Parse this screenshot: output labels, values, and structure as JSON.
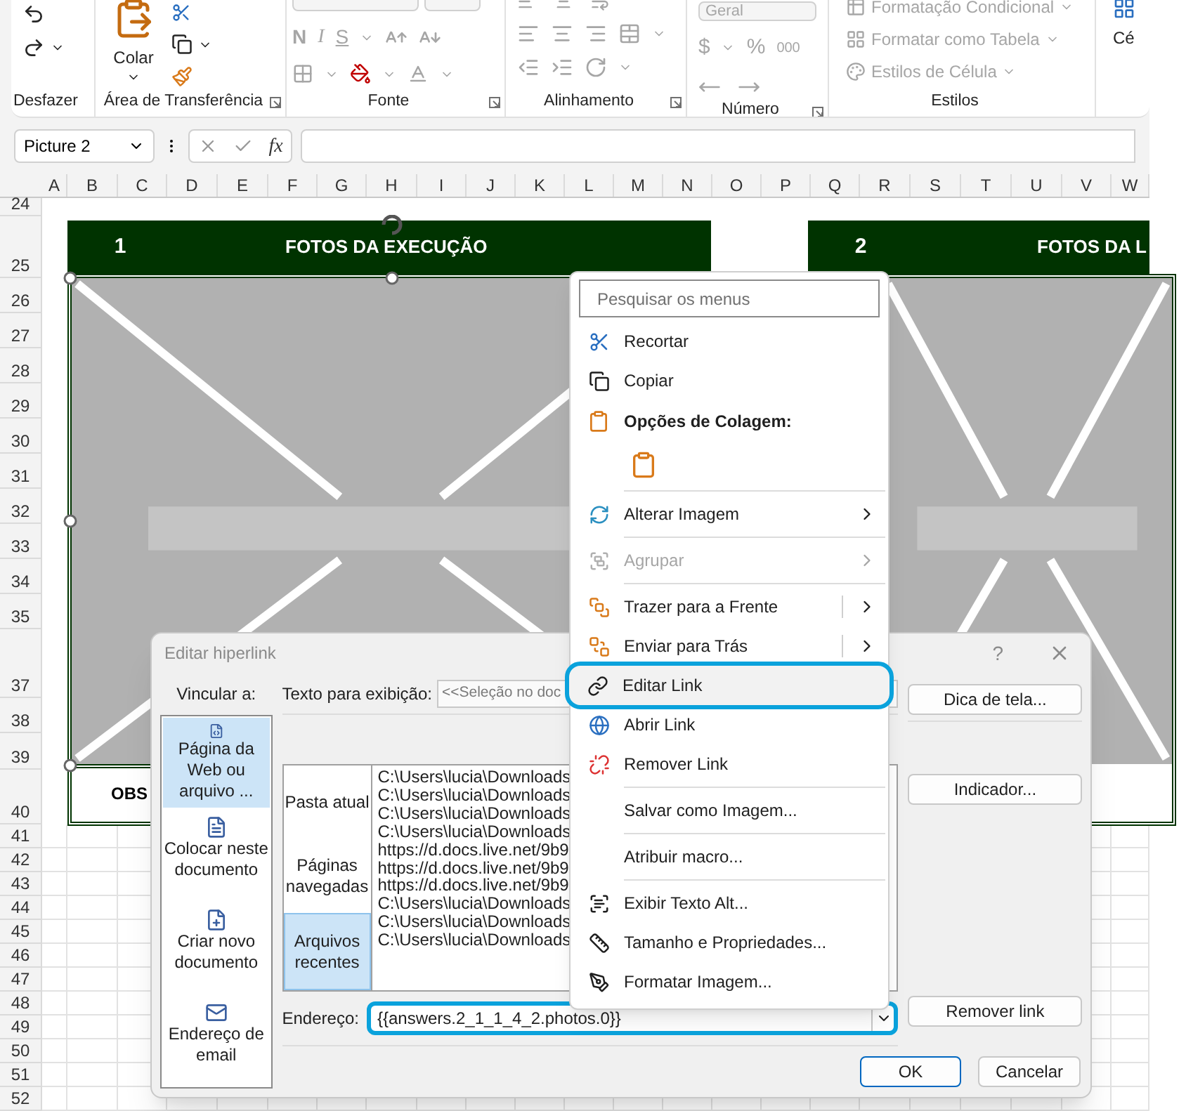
{
  "ribbon": {
    "groups": [
      {
        "kind": "undo",
        "label": "Desfazer",
        "disabled": false
      },
      {
        "kind": "clipboard",
        "label": "Área de Transferência",
        "disabled": false,
        "paste": "Colar"
      },
      {
        "kind": "font",
        "label": "Fonte",
        "disabled": true,
        "bold": "N",
        "italic": "I",
        "underline": "S"
      },
      {
        "kind": "alignment",
        "label": "Alinhamento",
        "disabled": true
      },
      {
        "kind": "number",
        "label": "Número",
        "disabled": true,
        "format": "Geral",
        "currency": "$",
        "percent": "%",
        "thousands": "000"
      },
      {
        "kind": "styles",
        "label": "Estilos",
        "disabled": true,
        "items": [
          "Formatação Condicional",
          "Formatar como Tabela",
          "Estilos de Célula"
        ]
      },
      {
        "kind": "cells",
        "label": "Cé",
        "disabled": false
      }
    ]
  },
  "formula_bar": {
    "name_box": "Picture 2",
    "function_label": "fx"
  },
  "sheet": {
    "columns": [
      "A",
      "B",
      "C",
      "D",
      "E",
      "F",
      "G",
      "H",
      "I",
      "J",
      "K",
      "L",
      "M",
      "N",
      "O",
      "P",
      "Q",
      "R",
      "S",
      "T",
      "U",
      "V",
      "W"
    ],
    "rows": [
      "24",
      "25",
      "26",
      "27",
      "28",
      "29",
      "30",
      "31",
      "32",
      "33",
      "34",
      "35",
      "37",
      "38",
      "39",
      "40",
      "41",
      "42",
      "43",
      "44",
      "45",
      "46",
      "47",
      "48",
      "49",
      "50",
      "51",
      "52"
    ],
    "blocks": [
      {
        "number": "1",
        "title": "FOTOS DA EXECUÇÃO"
      },
      {
        "number": "2",
        "title": "FOTOS DA L"
      }
    ],
    "obs": "OBS"
  },
  "context_menu": {
    "search_placeholder": "Pesquisar os menus",
    "items": [
      {
        "kind": "item",
        "label": "Recortar",
        "selected": false,
        "disabled": false,
        "submenu": false,
        "split": false,
        "circled": false
      },
      {
        "kind": "item",
        "label": "Copiar",
        "selected": false,
        "disabled": false,
        "submenu": false,
        "split": false,
        "circled": false
      },
      {
        "kind": "header",
        "label": "Opções de Colagem:"
      },
      {
        "kind": "paste_options"
      },
      {
        "kind": "separator"
      },
      {
        "kind": "item",
        "label": "Alterar Imagem",
        "selected": false,
        "disabled": false,
        "submenu": true,
        "split": false,
        "circled": false
      },
      {
        "kind": "separator"
      },
      {
        "kind": "item",
        "label": "Agrupar",
        "selected": false,
        "disabled": true,
        "submenu": true,
        "split": false,
        "circled": false
      },
      {
        "kind": "separator"
      },
      {
        "kind": "item",
        "label": "Trazer para a Frente",
        "selected": false,
        "disabled": false,
        "submenu": true,
        "split": true,
        "circled": false
      },
      {
        "kind": "item",
        "label": "Enviar para Trás",
        "selected": false,
        "disabled": false,
        "submenu": true,
        "split": true,
        "circled": false
      },
      {
        "kind": "item",
        "label": "Editar Link",
        "selected": true,
        "disabled": false,
        "submenu": false,
        "split": false,
        "circled": true
      },
      {
        "kind": "item",
        "label": "Abrir Link",
        "selected": false,
        "disabled": false,
        "submenu": false,
        "split": false,
        "circled": false
      },
      {
        "kind": "item",
        "label": "Remover Link",
        "selected": false,
        "disabled": false,
        "submenu": false,
        "split": false,
        "circled": false
      },
      {
        "kind": "separator"
      },
      {
        "kind": "item",
        "label": "Salvar como Imagem...",
        "selected": false,
        "disabled": false,
        "submenu": false,
        "split": false,
        "circled": false
      },
      {
        "kind": "separator"
      },
      {
        "kind": "item",
        "label": "Atribuir macro...",
        "selected": false,
        "disabled": false,
        "submenu": false,
        "split": false,
        "circled": false
      },
      {
        "kind": "separator"
      },
      {
        "kind": "item",
        "label": "Exibir Texto Alt...",
        "selected": false,
        "disabled": false,
        "submenu": false,
        "split": false,
        "circled": false
      },
      {
        "kind": "item",
        "label": "Tamanho e Propriedades...",
        "selected": false,
        "disabled": false,
        "submenu": false,
        "split": false,
        "circled": false
      },
      {
        "kind": "item",
        "label": "Formatar Imagem...",
        "selected": false,
        "disabled": false,
        "submenu": false,
        "split": false,
        "circled": false
      }
    ]
  },
  "dialog": {
    "title": "Editar hiperlink",
    "help": "?",
    "link_to_label": "Vincular a:",
    "link_targets": [
      {
        "label": "Página da Web ou arquivo ...",
        "selected": true
      },
      {
        "label": "Colocar neste documento",
        "selected": false
      },
      {
        "label": "Criar novo documento",
        "selected": false
      },
      {
        "label": "Endereço de email",
        "selected": false
      }
    ],
    "display_text_label": "Texto para exibição:",
    "display_text": "<<Seleção no doc",
    "screen_tip_button": "Dica de tela...",
    "look_in_tabs": [
      {
        "label": "Pasta atual",
        "selected": false
      },
      {
        "label": "Páginas navegadas",
        "selected": false
      },
      {
        "label": "Arquivos recentes",
        "selected": true
      }
    ],
    "files": [
      "C:\\Users\\lucia\\Downloads",
      "C:\\Users\\lucia\\Downloads",
      "C:\\Users\\lucia\\Downloads",
      "C:\\Users\\lucia\\Downloads",
      "https://d.docs.live.net/9b9",
      "https://d.docs.live.net/9b9",
      "https://d.docs.live.net/9b9",
      "C:\\Users\\lucia\\Downloads",
      "C:\\Users\\lucia\\Downloads",
      "C:\\Users\\lucia\\Downloads"
    ],
    "bookmark_button": "Indicador...",
    "address_label": "Endereço:",
    "address": "{{answers.2_1_1_4_2.photos.0}}",
    "address_circled": true,
    "remove_link_button": "Remover link",
    "ok_button": "OK",
    "cancel_button": "Cancelar"
  }
}
